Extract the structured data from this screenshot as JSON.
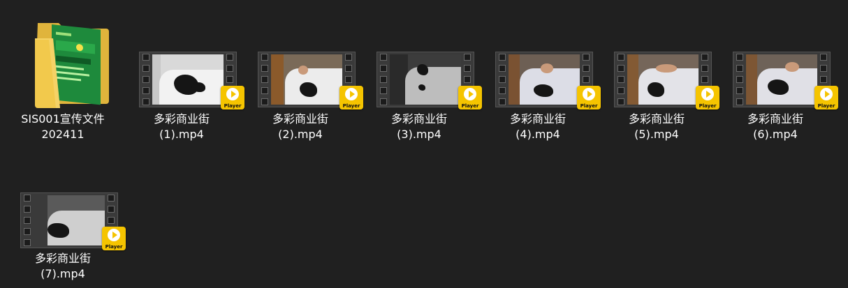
{
  "colors": {
    "background": "#202020",
    "label_text": "#ffffff",
    "badge": "#f5c400",
    "folder_body": "#f2c94c",
    "folder_inner": "#1e8a3c"
  },
  "items": [
    {
      "type": "folder",
      "icon": "folder-icon",
      "label": "SIS001宣传文件\n202411"
    },
    {
      "type": "video",
      "icon": "video-file-icon",
      "badge": "Player",
      "label": "多彩商业街\n(1).mp4"
    },
    {
      "type": "video",
      "icon": "video-file-icon",
      "badge": "Player",
      "label": "多彩商业街\n(2).mp4"
    },
    {
      "type": "video",
      "icon": "video-file-icon",
      "badge": "Player",
      "label": "多彩商业街\n(3).mp4"
    },
    {
      "type": "video",
      "icon": "video-file-icon",
      "badge": "Player",
      "label": "多彩商业街\n(4).mp4"
    },
    {
      "type": "video",
      "icon": "video-file-icon",
      "badge": "Player",
      "label": "多彩商业街\n(5).mp4"
    },
    {
      "type": "video",
      "icon": "video-file-icon",
      "badge": "Player",
      "label": "多彩商业街\n(6).mp4"
    },
    {
      "type": "video",
      "icon": "video-file-icon",
      "badge": "Player",
      "label": "多彩商业街\n(7).mp4"
    }
  ]
}
